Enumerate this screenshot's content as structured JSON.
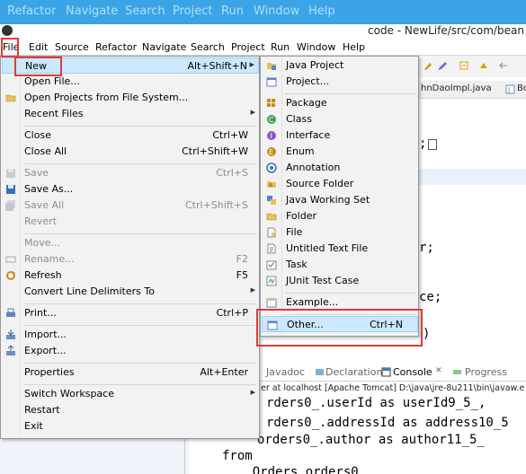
{
  "desktop_menu": [
    "Refactor",
    "Navigate",
    "Search",
    "Project",
    "Run",
    "Window",
    "Help"
  ],
  "window_title": "code - NewLife/src/com/bean",
  "menubar": [
    "File",
    "Edit",
    "Source",
    "Refactor",
    "Navigate",
    "Search",
    "Project",
    "Run",
    "Window",
    "Help"
  ],
  "editor_tabs": [
    "hnDaoImpl.java",
    "Bo"
  ],
  "code_fragments": {
    "line1": ";",
    "line2": "r;",
    "line3": "ce;",
    "line4": ")"
  },
  "views_tabs": [
    "Javadoc",
    "Declaration",
    "Console",
    "Progress"
  ],
  "console_header": "er at localhost [Apache Tomcat] D:\\java\\jre-8u211\\bin\\javaw.e",
  "console_lines": [
    "rders0_.userId as userId9_5_,",
    "rders0_.addressId as address10_5",
    "orders0_.author as author11_5_",
    "from",
    "    Orders orders0_"
  ],
  "file_menu": {
    "items": [
      {
        "label": "New",
        "shortcut": "Alt+Shift+N",
        "submenu": true,
        "highlighted": true
      },
      {
        "label": "Open File...",
        "shortcut": ""
      },
      {
        "label": "Open Projects from File System...",
        "shortcut": ""
      },
      {
        "label": "Recent Files",
        "shortcut": "",
        "submenu": true
      },
      {
        "label": "Close",
        "shortcut": "Ctrl+W"
      },
      {
        "label": "Close All",
        "shortcut": "Ctrl+Shift+W"
      },
      {
        "label": "Save",
        "shortcut": "Ctrl+S",
        "disabled": true
      },
      {
        "label": "Save As...",
        "shortcut": ""
      },
      {
        "label": "Save All",
        "shortcut": "Ctrl+Shift+S",
        "disabled": true
      },
      {
        "label": "Revert",
        "shortcut": "",
        "disabled": true
      },
      {
        "label": "Move...",
        "shortcut": "",
        "disabled": true
      },
      {
        "label": "Rename...",
        "shortcut": "F2",
        "disabled": true
      },
      {
        "label": "Refresh",
        "shortcut": "F5"
      },
      {
        "label": "Convert Line Delimiters To",
        "shortcut": "",
        "submenu": true
      },
      {
        "label": "Print...",
        "shortcut": "Ctrl+P"
      },
      {
        "label": "Import...",
        "shortcut": ""
      },
      {
        "label": "Export...",
        "shortcut": ""
      },
      {
        "label": "Properties",
        "shortcut": "Alt+Enter"
      },
      {
        "label": "Switch Workspace",
        "shortcut": "",
        "submenu": true
      },
      {
        "label": "Restart",
        "shortcut": ""
      },
      {
        "label": "Exit",
        "shortcut": ""
      }
    ]
  },
  "new_submenu": {
    "items": [
      {
        "label": "Java Project",
        "shortcut": ""
      },
      {
        "label": "Project...",
        "shortcut": ""
      },
      {
        "label": "Package",
        "shortcut": ""
      },
      {
        "label": "Class",
        "shortcut": ""
      },
      {
        "label": "Interface",
        "shortcut": ""
      },
      {
        "label": "Enum",
        "shortcut": ""
      },
      {
        "label": "Annotation",
        "shortcut": ""
      },
      {
        "label": "Source Folder",
        "shortcut": ""
      },
      {
        "label": "Java Working Set",
        "shortcut": ""
      },
      {
        "label": "Folder",
        "shortcut": ""
      },
      {
        "label": "File",
        "shortcut": ""
      },
      {
        "label": "Untitled Text File",
        "shortcut": ""
      },
      {
        "label": "Task",
        "shortcut": ""
      },
      {
        "label": "JUnit Test Case",
        "shortcut": ""
      },
      {
        "label": "Example...",
        "shortcut": ""
      },
      {
        "label": "Other...",
        "shortcut": "Ctrl+N",
        "highlighted": true
      }
    ]
  },
  "colors": {
    "highlight_bg": "#cce8ff",
    "annotation_red": "#e53935",
    "desktop_bar": "#3aa4e6"
  }
}
